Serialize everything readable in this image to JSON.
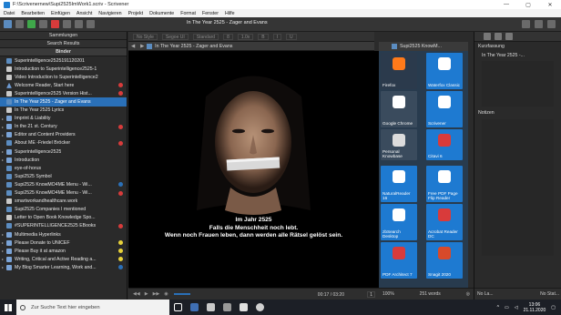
{
  "window": {
    "title": "F:\\Scrivenernew\\Supi2525ImWork1.scriv - Scrivener",
    "min": "—",
    "max": "▢",
    "close": "✕"
  },
  "menu": [
    "Datei",
    "Bearbeiten",
    "Einfügen",
    "Ansicht",
    "Navigieren",
    "Projekt",
    "Dokumente",
    "Format",
    "Fenster",
    "Hilfe"
  ],
  "toolbar": {
    "doc_title": "In The Year 2525 - Zager and Evans"
  },
  "format_bar": {
    "style": "No Style",
    "font": "Segoe UI",
    "weight": "Standard",
    "size": "8",
    "spacing": "1.0x",
    "bold": "B",
    "italic": "I",
    "underline": "U"
  },
  "binder": {
    "collections_label": "Sammlungen",
    "search_results_label": "Search Results",
    "binder_label": "Binder",
    "items": [
      {
        "label": "Superintelligence2525191120201",
        "icon": "img",
        "dot": ""
      },
      {
        "label": "Introduction to Superintelligence2525-1",
        "icon": "doc",
        "dot": ""
      },
      {
        "label": "Video Introduction to Superintelligence2",
        "icon": "doc",
        "dot": ""
      },
      {
        "label": "Welcome Reader, Start here",
        "icon": "tri",
        "dot": "#d83b3b"
      },
      {
        "label": "Superintelligence2525 Version Hist...",
        "icon": "doc",
        "dot": "#d83b3b"
      },
      {
        "label": "In The Year 2525 - Zager and Evans",
        "icon": "img",
        "dot": "",
        "selected": true
      },
      {
        "label": "In The Year 2525 Lyrics",
        "icon": "doc",
        "dot": ""
      },
      {
        "label": "Imprint & Liability",
        "icon": "folder",
        "dot": ""
      },
      {
        "label": "In the 21 st. Century",
        "icon": "folder",
        "dot": "#d83b3b"
      },
      {
        "label": "Editor and Content Providers",
        "icon": "folder",
        "dot": ""
      },
      {
        "label": "About ME -Friedel Bröcker",
        "icon": "img",
        "dot": "#d83b3b"
      },
      {
        "label": "Superintelligence2525",
        "icon": "folder",
        "dot": ""
      },
      {
        "label": "Introduction",
        "icon": "folder",
        "dot": ""
      },
      {
        "label": "eye-of-horus",
        "icon": "img",
        "dot": ""
      },
      {
        "label": "Supi2525 Symbol",
        "icon": "img",
        "dot": ""
      },
      {
        "label": "Supi2525 KnowMO4ME Menu - Wi...",
        "icon": "img",
        "dot": "#2a70b8"
      },
      {
        "label": "Supi2525 KnowMO4ME Menu - Wi...",
        "icon": "img",
        "dot": "#d83b3b"
      },
      {
        "label": "smartworkandhealthcare.work",
        "icon": "doc",
        "dot": ""
      },
      {
        "label": "Supi2525 Companies I mentioned",
        "icon": "img",
        "dot": ""
      },
      {
        "label": "Letter to Open Book Knowledge Spo...",
        "icon": "doc",
        "dot": ""
      },
      {
        "label": "#SUPERINTELLIGENCE2525 EBooks",
        "icon": "img",
        "dot": "#d83b3b"
      },
      {
        "label": "Multimedia Hyperlinks",
        "icon": "folder",
        "dot": ""
      },
      {
        "label": "Please Donate to UNICEF",
        "icon": "folder",
        "dot": "#e8d23a"
      },
      {
        "label": "Please Buy it at amazon",
        "icon": "folder",
        "dot": "#e8d23a"
      },
      {
        "label": "Writing, Critical and Active Reading a...",
        "icon": "folder",
        "dot": "#e8d23a"
      },
      {
        "label": "My Blog Smarter Learning, Work and...",
        "icon": "folder",
        "dot": "#2a70b8"
      }
    ]
  },
  "editor": {
    "header_title": "In The Year 2525 - Zager and Evans",
    "overlay_line1": "Im Jahr 2525",
    "overlay_line2": "Falls die Menschheit noch lebt.",
    "overlay_line3": "Wenn noch Frauen leben, dann werden alle Rätsel gelöst sein.",
    "time": "00:17 / 03:20",
    "zoom": "1"
  },
  "start_panel": {
    "header_title": "Supi2525 KnowM...",
    "tiles": [
      {
        "label": "Firefox",
        "color": "#2b3a4c"
      },
      {
        "label": "Waterfox Classic",
        "color": "#1e7ad1"
      },
      {
        "label": "Google Chrome",
        "color": "#3a4b5d"
      },
      {
        "label": "Scrivener",
        "color": "#1e7ad1"
      },
      {
        "label": "Personal Knowbase",
        "color": "#3a4b5d"
      },
      {
        "label": "Citavi 6",
        "color": "#1e7ad1"
      },
      {
        "label": "NaturalReader 16",
        "color": "#1e7ad1"
      },
      {
        "label": "Free PDF Page Flip Reader",
        "color": "#1e7ad1"
      },
      {
        "label": "zbSearch Desktop",
        "color": "#1e7ad1"
      },
      {
        "label": "Acrobat Reader DC",
        "color": "#1e7ad1"
      },
      {
        "label": "PDF Architect 7",
        "color": "#1e7ad1"
      },
      {
        "label": "Snagit 2020",
        "color": "#1e7ad1"
      }
    ]
  },
  "inspector": {
    "summary_label": "Kurzfassung",
    "summary_value": "In The Year 2525 -...",
    "notes_label": "Notizen"
  },
  "footer": {
    "zoom": "100%",
    "words": "251 words",
    "label": "No La...",
    "status": "No Stat..."
  },
  "taskbar": {
    "search_placeholder": "Zur Suche Text hier eingeben",
    "time": "13:06",
    "date": "21.11.2020"
  }
}
